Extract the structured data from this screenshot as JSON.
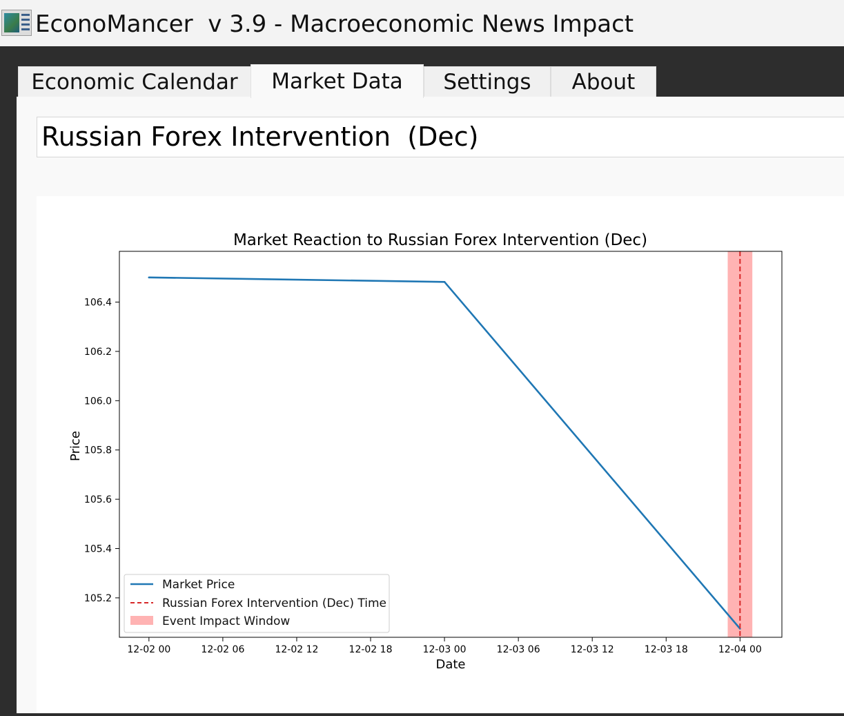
{
  "window": {
    "title": "EconoMancer  v 3.9 - Macroeconomic News Impact",
    "icon": "app-chart-icon"
  },
  "tabs": [
    {
      "label": "Economic Calendar",
      "active": false
    },
    {
      "label": "Market Data",
      "active": true
    },
    {
      "label": "Settings",
      "active": false
    },
    {
      "label": "About",
      "active": false
    }
  ],
  "event_field": {
    "value": "Russian Forex Intervention  (Dec)"
  },
  "chart_data": {
    "type": "line",
    "title": "Market Reaction to Russian Forex Intervention  (Dec)",
    "xlabel": "Date",
    "ylabel": "Price",
    "x_ticks": [
      "12-02 00",
      "12-02 06",
      "12-02 12",
      "12-02 18",
      "12-03 00",
      "12-03 06",
      "12-03 12",
      "12-03 18",
      "12-04 00"
    ],
    "x_tick_hours": [
      0,
      6,
      12,
      18,
      24,
      30,
      36,
      42,
      48
    ],
    "xlim_hours": [
      -2.4,
      51.4
    ],
    "y_ticks": [
      105.2,
      105.4,
      105.6,
      105.8,
      106.0,
      106.2,
      106.4
    ],
    "ylim": [
      105.04,
      106.606
    ],
    "series": [
      {
        "name": "Market Price",
        "color": "#1f77b4",
        "x": [
          "12-02 00",
          "12-03 00",
          "12-04 00"
        ],
        "x_hours": [
          0,
          24,
          48
        ],
        "values": [
          106.5,
          106.482,
          105.075
        ]
      }
    ],
    "event_line": {
      "name": "Russian Forex Intervention  (Dec) Time",
      "x": "12-04 00",
      "x_hours": 48,
      "color": "#d62728"
    },
    "impact_window": {
      "name": "Event Impact Window",
      "x_start_hours": 47,
      "x_end_hours": 49,
      "color": "#ff9999"
    },
    "legend_position": "lower-left",
    "grid": false
  }
}
